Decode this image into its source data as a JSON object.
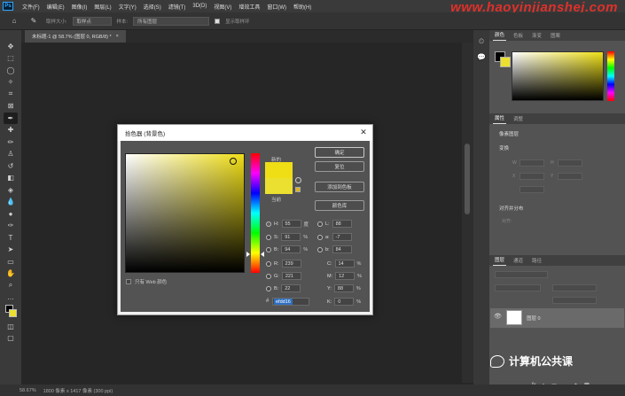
{
  "menubar": {
    "logo": "Ps",
    "items": [
      "文件(F)",
      "编辑(E)",
      "图像(I)",
      "图层(L)",
      "文字(Y)",
      "选择(S)",
      "滤镜(T)",
      "3D(D)",
      "视图(V)",
      "增效工具",
      "窗口(W)",
      "帮助(H)"
    ]
  },
  "watermark": "www.haoyinjianshej.com",
  "options": {
    "sample_size_label": "取样大小:",
    "sample_size_value": "取样点",
    "sample_label": "样本:",
    "sample_value": "所有图层",
    "show_ring_label": "显示取样环"
  },
  "document": {
    "tab_title": "未标题-1 @ 58.7% (图层 0, RGB/8) *",
    "tab_close": "×"
  },
  "status": {
    "zoom": "58.67%",
    "info": "1800 像素 x 1417 像素 (300 ppi)"
  },
  "panels": {
    "color_tabs": [
      "颜色",
      "色板",
      "渐变",
      "图案"
    ],
    "props_tabs": [
      "属性",
      "调整"
    ],
    "props_header": "像素图层",
    "transform_label": "变换",
    "w_label": "W",
    "h_label": "H",
    "x_label": "X",
    "y_label": "Y",
    "align_label": "对齐并分布",
    "align_sub": "对齐:",
    "layers_tabs": [
      "图层",
      "通道",
      "路径"
    ],
    "layer_name": "图层 0",
    "bottom_icons": [
      "fx",
      "◐",
      "▣",
      "▭",
      "+",
      "🗑"
    ]
  },
  "dialog": {
    "title": "拾色器 (背景色)",
    "close": "✕",
    "new_label": "新的",
    "current_label": "当前",
    "buttons": {
      "ok": "确定",
      "reset": "复位",
      "add_swatch": "添加到色板",
      "libraries": "颜色库"
    },
    "fields": {
      "H": {
        "label": "H:",
        "value": "55",
        "unit": "度"
      },
      "S": {
        "label": "S:",
        "value": "91",
        "unit": "%"
      },
      "B": {
        "label": "B:",
        "value": "94",
        "unit": "%"
      },
      "R": {
        "label": "R:",
        "value": "239",
        "unit": ""
      },
      "G": {
        "label": "G:",
        "value": "221",
        "unit": ""
      },
      "Bl": {
        "label": "B:",
        "value": "22",
        "unit": ""
      },
      "L": {
        "label": "L:",
        "value": "88",
        "unit": ""
      },
      "a": {
        "label": "a:",
        "value": "-7",
        "unit": ""
      },
      "b": {
        "label": "b:",
        "value": "84",
        "unit": ""
      },
      "C": {
        "label": "C:",
        "value": "14",
        "unit": "%"
      },
      "M": {
        "label": "M:",
        "value": "12",
        "unit": "%"
      },
      "Y": {
        "label": "Y:",
        "value": "88",
        "unit": "%"
      },
      "K": {
        "label": "K:",
        "value": "0",
        "unit": "%"
      }
    },
    "hex_label": "#",
    "hex_value": "efdd16",
    "web_only": "只有 Web 颜色",
    "new_color": "#efdd16",
    "current_color": "#ebe030"
  },
  "brand": "计算机公共课"
}
